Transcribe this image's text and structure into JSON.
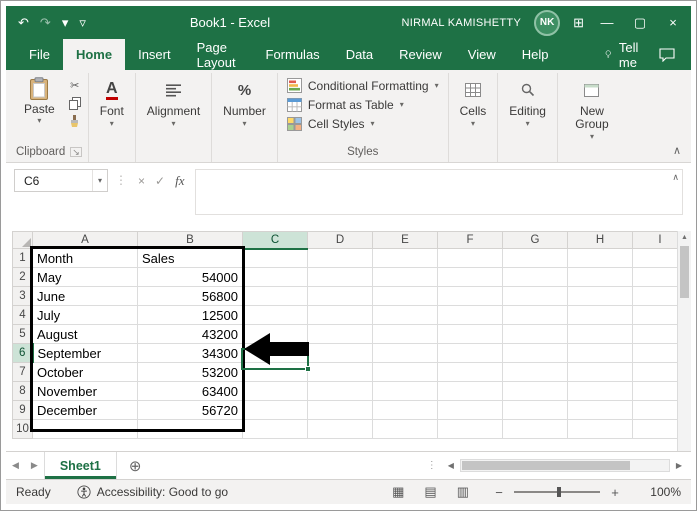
{
  "icons": {
    "undo": "↶",
    "redo": "↷",
    "dropdown": "▾",
    "qat_customize": "▿",
    "ribbon_display": "⊞",
    "minimize": "—",
    "maximize": "▢",
    "close": "×",
    "cut": "✂",
    "dialog_launcher": "↘",
    "cancel": "×",
    "enter": "✓",
    "fx": "fx",
    "dots": "⋮",
    "nav_left": "◀",
    "nav_right": "▶",
    "scroll_up": "▲",
    "add_sheet": "⊕",
    "zoom_out": "−",
    "zoom_in": "+",
    "chevron_up": "∧",
    "font_glyph": "A",
    "percent_glyph": "%",
    "view_normal": "▦",
    "view_page_layout": "▤",
    "view_page_break": "▥"
  },
  "title_bar": {
    "title": "Book1  -  Excel",
    "user_name": "NIRMAL KAMISHETTY",
    "user_initials": "NK"
  },
  "tabs": {
    "items": [
      "File",
      "Home",
      "Insert",
      "Page Layout",
      "Formulas",
      "Data",
      "Review",
      "View",
      "Help"
    ],
    "active": "Home",
    "tell_me": "Tell me"
  },
  "ribbon": {
    "paste_label": "Paste",
    "clipboard_group_label": "Clipboard",
    "font_group_label": "Font",
    "alignment_group_label": "Alignment",
    "number_group_label": "Number",
    "conditional_formatting_label": "Conditional Formatting",
    "format_as_table_label": "Format as Table",
    "cell_styles_label": "Cell Styles",
    "styles_group_label": "Styles",
    "cells_group_label": "Cells",
    "editing_group_label": "Editing",
    "new_group_label": "New Group"
  },
  "formula_bar": {
    "name_box_value": "C6"
  },
  "grid": {
    "columns": [
      "A",
      "B",
      "C",
      "D",
      "E",
      "F",
      "G",
      "H",
      "I"
    ],
    "selected_column": "C",
    "selected_row": 6,
    "selected_cell": "C6",
    "rows": [
      {
        "num": 1,
        "cells": [
          "Month",
          "Sales"
        ]
      },
      {
        "num": 2,
        "cells": [
          "May",
          "54000"
        ]
      },
      {
        "num": 3,
        "cells": [
          "June",
          "56800"
        ]
      },
      {
        "num": 4,
        "cells": [
          "July",
          "12500"
        ]
      },
      {
        "num": 5,
        "cells": [
          "August",
          "43200"
        ]
      },
      {
        "num": 6,
        "cells": [
          "September",
          "34300"
        ]
      },
      {
        "num": 7,
        "cells": [
          "October",
          "53200"
        ]
      },
      {
        "num": 8,
        "cells": [
          "November",
          "63400"
        ]
      },
      {
        "num": 9,
        "cells": [
          "December",
          "56720"
        ]
      },
      {
        "num": 10,
        "cells": [
          "",
          ""
        ]
      }
    ]
  },
  "sheet_bar": {
    "active_sheet": "Sheet1"
  },
  "status_bar": {
    "mode": "Ready",
    "accessibility": "Accessibility: Good to go",
    "zoom_level": "100%"
  }
}
